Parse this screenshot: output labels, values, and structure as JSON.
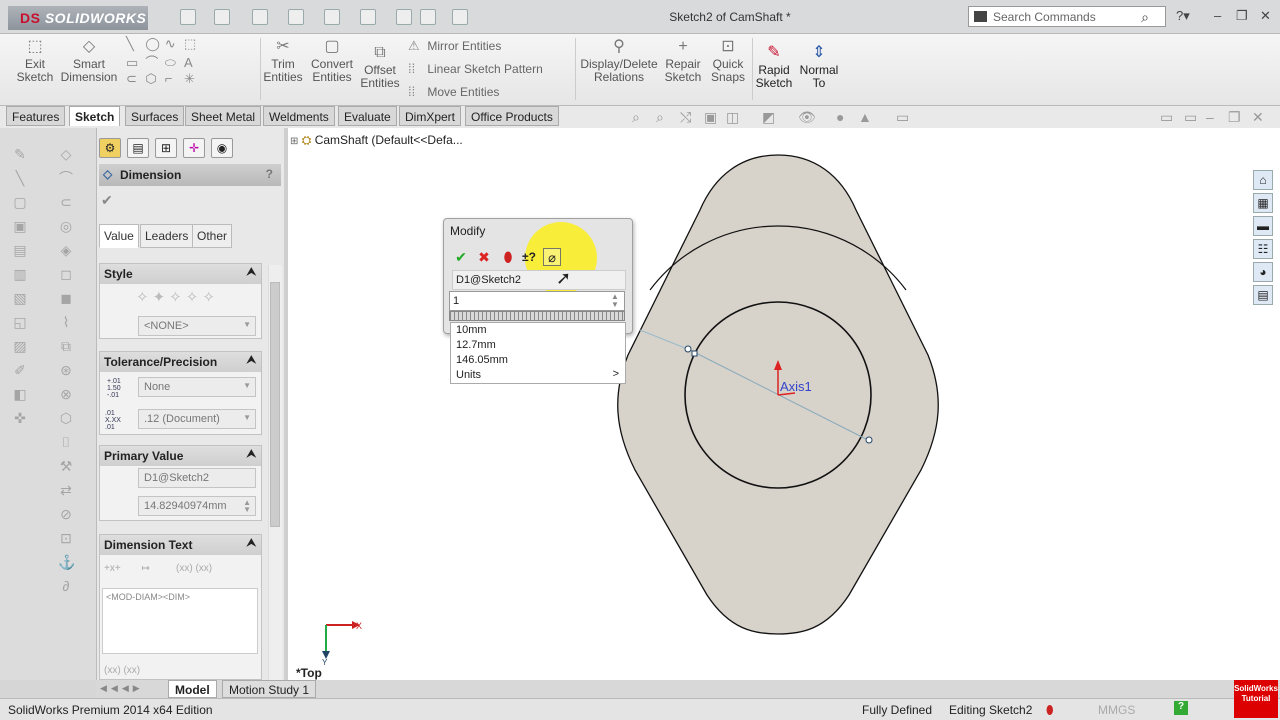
{
  "app": {
    "logo_text": "SOLIDWORKS",
    "logo_mark": "DS",
    "window_title": "Sketch2 of CamShaft *"
  },
  "search": {
    "placeholder": "Search Commands"
  },
  "command_manager": {
    "exit_sketch": "Exit\nSketch",
    "smart_dimension": "Smart\nDimension",
    "trim_entities": "Trim\nEntities",
    "convert_entities": "Convert\nEntities",
    "offset_entities": "Offset\nEntities",
    "mirror_entities": "Mirror Entities",
    "linear_sketch_pattern": "Linear Sketch Pattern",
    "move_entities": "Move Entities",
    "display_delete_relations": "Display/Delete\nRelations",
    "repair_sketch": "Repair\nSketch",
    "quick_snaps": "Quick\nSnaps",
    "rapid_sketch": "Rapid\nSketch",
    "normal_to": "Normal\nTo"
  },
  "tabs": [
    "Features",
    "Sketch",
    "Surfaces",
    "Sheet Metal",
    "Weldments",
    "Evaluate",
    "DimXpert",
    "Office Products"
  ],
  "active_tab": "Sketch",
  "tree": {
    "path": "CamShaft  (Default<<Defa..."
  },
  "property_manager": {
    "title": "Dimension",
    "help": "?",
    "tabs": [
      "Value",
      "Leaders",
      "Other"
    ],
    "style": {
      "header": "Style",
      "value": "<NONE>"
    },
    "tolerance": {
      "header": "Tolerance/Precision",
      "type": "None",
      "precision": ".12 (Document)",
      "icon1": "1.50",
      "icon2": ".01"
    },
    "primary_value": {
      "header": "Primary Value",
      "name": "D1@Sketch2",
      "value": "14.82940974mm"
    },
    "dimension_text": {
      "header": "Dimension Text",
      "text": "<MOD-DIAM><DIM>",
      "paren1": "(xx)",
      "paren2": "(xx)",
      "paren3": "(xx)",
      "paren4": "(xx)"
    }
  },
  "modify_dialog": {
    "title": "Modify",
    "dimension_name": "D1@Sketch2",
    "input_value": "1",
    "options": [
      "10mm",
      "12.7mm",
      "146.05mm",
      "Units"
    ]
  },
  "sketch": {
    "axis_label": "Axis1"
  },
  "triad": {
    "x": "X",
    "y": "Y",
    "view_name": "*Top"
  },
  "bottom_tabs": [
    "Model",
    "Motion Study 1"
  ],
  "status": {
    "edition": "SolidWorks Premium 2014 x64 Edition",
    "state": "Fully Defined",
    "editing": "Editing Sketch2",
    "units": "MMGS",
    "help": "?"
  },
  "brand": "SolidWorks\nTutorial",
  "colors": {
    "accent": "#2a5aa8",
    "highlight": "#fff000",
    "part": "#d7d2ca"
  }
}
